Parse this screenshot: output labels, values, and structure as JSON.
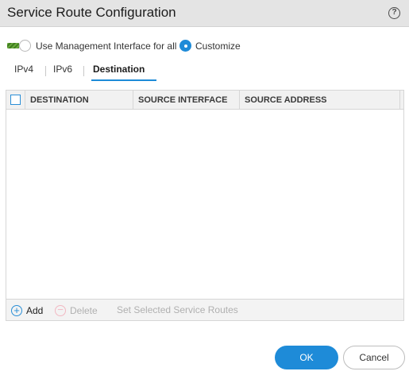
{
  "dialog": {
    "title": "Service Route Configuration",
    "help_icon": "help-circle-icon",
    "help_glyph": "?"
  },
  "mode": {
    "use_mgmt_label": "Use Management Interface for all",
    "use_mgmt_selected": false,
    "customize_label": "Customize",
    "customize_selected": true
  },
  "tabs": [
    {
      "label": "IPv4",
      "active": false
    },
    {
      "label": "IPv6",
      "active": false
    },
    {
      "label": "Destination",
      "active": true
    }
  ],
  "table": {
    "columns": [
      "DESTINATION",
      "SOURCE INTERFACE",
      "SOURCE ADDRESS"
    ],
    "rows": []
  },
  "footer": {
    "add_label": "Add",
    "add_glyph": "+",
    "delete_label": "Delete",
    "delete_glyph": "−",
    "set_routes_label": "Set Selected Service Routes"
  },
  "buttons": {
    "ok_label": "OK",
    "cancel_label": "Cancel"
  },
  "colors": {
    "accent": "#1e8bd8",
    "titlebar": "#e4e4e4"
  }
}
